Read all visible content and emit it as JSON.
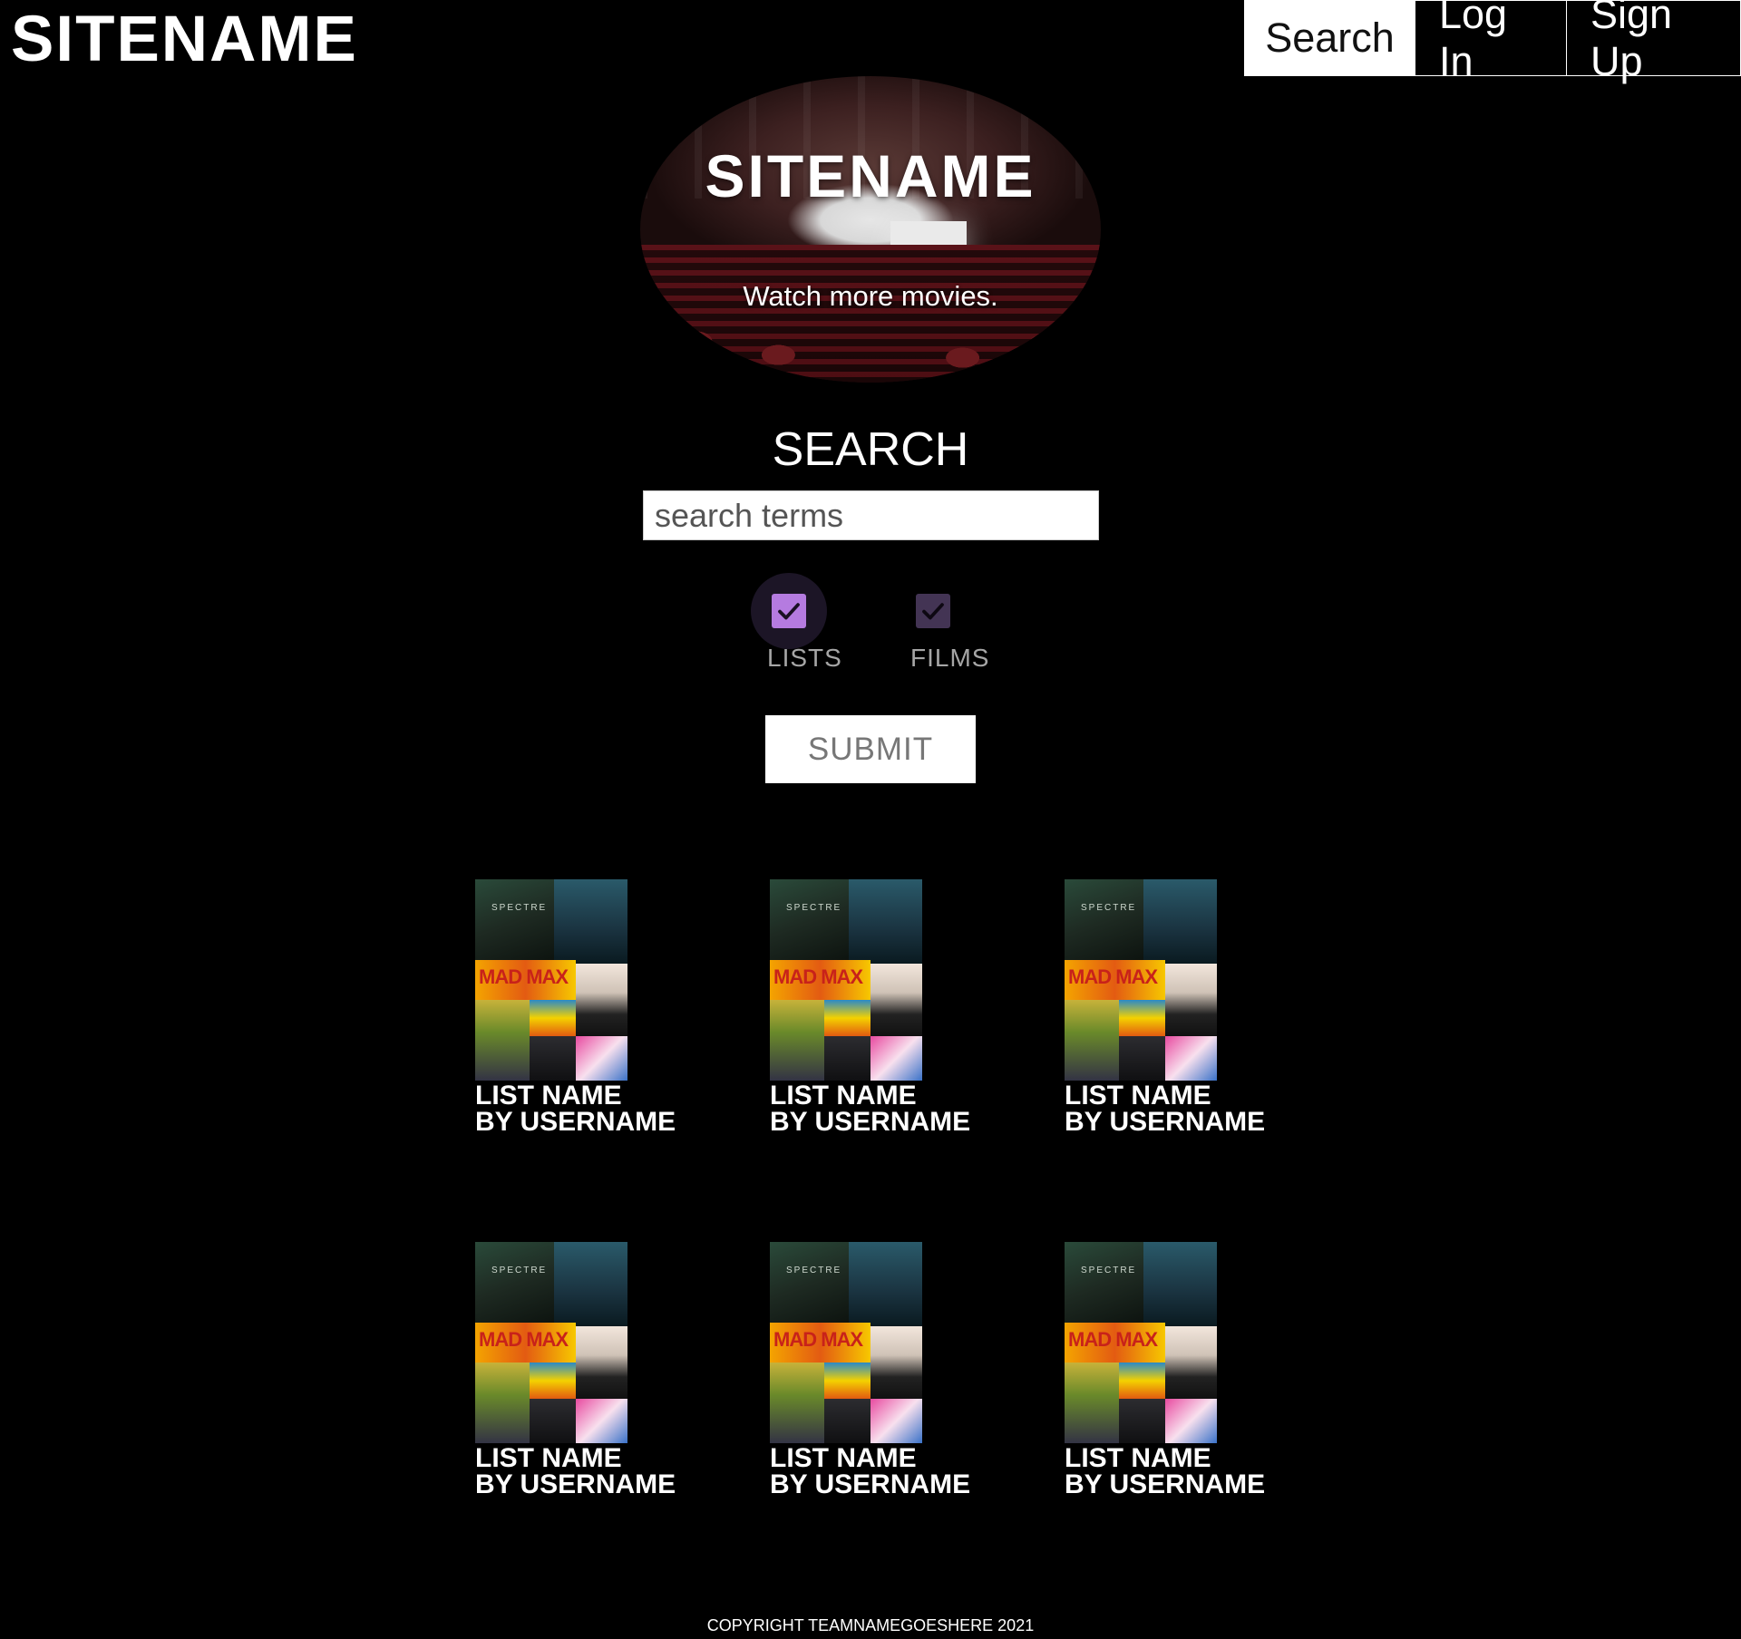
{
  "header": {
    "logo": "SITENAME",
    "nav": [
      {
        "label": "Search",
        "active": true
      },
      {
        "label": "Log In",
        "active": false
      },
      {
        "label": "Sign Up",
        "active": false
      }
    ]
  },
  "hero": {
    "title": "SITENAME",
    "tagline": "Watch more movies."
  },
  "search": {
    "heading": "SEARCH",
    "placeholder": "search terms",
    "value": "",
    "filters": [
      {
        "label": "LISTS",
        "checked": true
      },
      {
        "label": "FILMS",
        "checked": true
      }
    ],
    "submit_label": "SUBMIT"
  },
  "lists": [
    {
      "title": "LIST NAME",
      "author": "BY USERNAME"
    },
    {
      "title": "LIST NAME",
      "author": "BY USERNAME"
    },
    {
      "title": "LIST NAME",
      "author": "BY USERNAME"
    },
    {
      "title": "LIST NAME",
      "author": "BY USERNAME"
    },
    {
      "title": "LIST NAME",
      "author": "BY USERNAME"
    },
    {
      "title": "LIST NAME",
      "author": "BY USERNAME"
    }
  ],
  "footer": {
    "copyright": "COPYRIGHT TEAMNAMEGOESHERE 2021"
  },
  "colors": {
    "background": "#000000",
    "text": "#ffffff",
    "checkbox_active": "#b57be0",
    "checkbox_dim": "#433454"
  },
  "icons": {
    "checkbox": "check-icon"
  }
}
